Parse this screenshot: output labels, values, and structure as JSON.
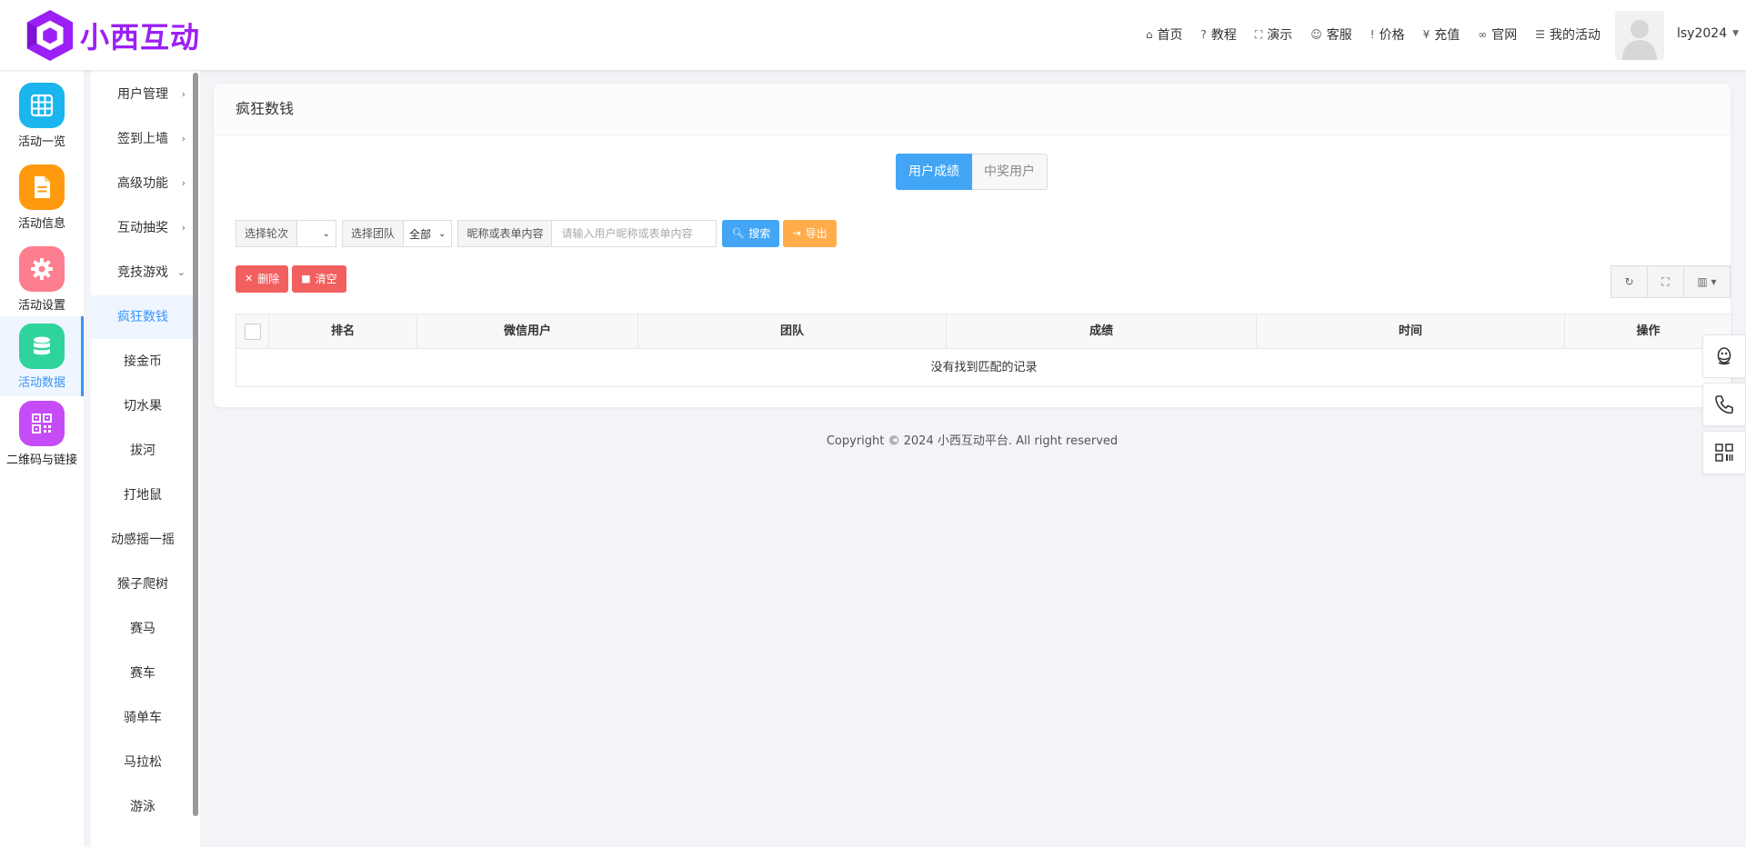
{
  "brand": {
    "logo_text": "小西互动"
  },
  "topnav": [
    {
      "icon": "⌂",
      "label": "首页"
    },
    {
      "icon": "?",
      "label": "教程"
    },
    {
      "icon": "⛶",
      "label": "演示"
    },
    {
      "icon": "☺",
      "label": "客服"
    },
    {
      "icon": "!",
      "label": "价格"
    },
    {
      "icon": "¥",
      "label": "充值"
    },
    {
      "icon": "∞",
      "label": "官网"
    },
    {
      "icon": "☰",
      "label": "我的活动"
    }
  ],
  "user": {
    "name": "lsy2024"
  },
  "icon_sidebar": [
    {
      "label": "活动一览",
      "color": "#1ab5ec"
    },
    {
      "label": "活动信息",
      "color": "#ff9a0e"
    },
    {
      "label": "活动设置",
      "color": "#fd7e8e"
    },
    {
      "label": "活动数据",
      "color": "#2fd39c"
    },
    {
      "label": "二维码与链接",
      "color": "#c64cf7"
    }
  ],
  "sub_menu": [
    {
      "label": "用户管理",
      "arrow": "›"
    },
    {
      "label": "签到上墙",
      "arrow": "›"
    },
    {
      "label": "高级功能",
      "arrow": "›"
    },
    {
      "label": "互动抽奖",
      "arrow": "›"
    },
    {
      "label": "竞技游戏",
      "arrow": "⌄"
    },
    {
      "label": "疯狂数钱",
      "arrow": ""
    },
    {
      "label": "接金币",
      "arrow": ""
    },
    {
      "label": "切水果",
      "arrow": ""
    },
    {
      "label": "拔河",
      "arrow": ""
    },
    {
      "label": "打地鼠",
      "arrow": ""
    },
    {
      "label": "动感摇一摇",
      "arrow": ""
    },
    {
      "label": "猴子爬树",
      "arrow": ""
    },
    {
      "label": "赛马",
      "arrow": ""
    },
    {
      "label": "赛车",
      "arrow": ""
    },
    {
      "label": "骑单车",
      "arrow": ""
    },
    {
      "label": "马拉松",
      "arrow": ""
    },
    {
      "label": "游泳",
      "arrow": ""
    }
  ],
  "panel": {
    "title": "疯狂数钱",
    "tabs": [
      "用户成绩",
      "中奖用户"
    ],
    "filters": {
      "round_label": "选择轮次",
      "round_value": "",
      "team_label": "选择团队",
      "team_value": "全部",
      "keyword_label": "昵称或表单内容",
      "keyword_placeholder": "请输入用户昵称或表单内容"
    },
    "buttons": {
      "search": "搜索",
      "export": "导出",
      "delete": "删除",
      "clear": "清空"
    },
    "table": {
      "columns": [
        "排名",
        "微信用户",
        "团队",
        "成绩",
        "时间",
        "操作"
      ],
      "empty_text": "没有找到匹配的记录"
    }
  },
  "footer": {
    "text": "Copyright © 2024 小西互动平台. All right reserved"
  }
}
